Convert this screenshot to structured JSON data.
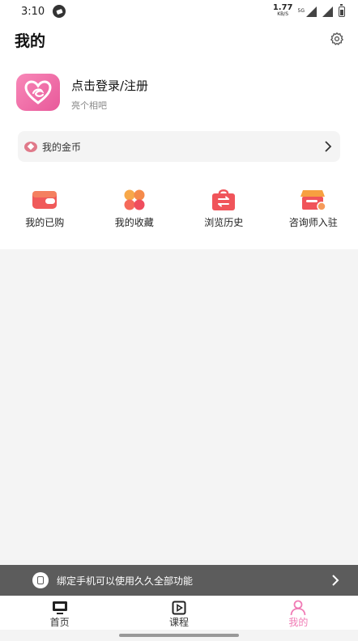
{
  "status_bar": {
    "time": "3:10",
    "net_speed_value": "1.77",
    "net_speed_unit": "KB/S",
    "signal_tag": "5G"
  },
  "header": {
    "title": "我的"
  },
  "profile": {
    "login_label": "点击登录/注册",
    "subtitle": "亮个相吧"
  },
  "coins": {
    "label": "我的金币"
  },
  "shortcuts": [
    {
      "label": "我的已购",
      "icon": "wallet-icon"
    },
    {
      "label": "我的收藏",
      "icon": "clover-icon"
    },
    {
      "label": "浏览历史",
      "icon": "history-bag-icon"
    },
    {
      "label": "咨询师入驻",
      "icon": "shop-icon"
    }
  ],
  "bind_banner": {
    "text": "绑定手机可以使用久久全部功能"
  },
  "tabbar": {
    "items": [
      {
        "label": "首页",
        "icon": "monitor-icon",
        "active": false
      },
      {
        "label": "课程",
        "icon": "video-course-icon",
        "active": false
      },
      {
        "label": "我的",
        "icon": "user-icon",
        "active": true
      }
    ]
  },
  "colors": {
    "accent_pink": "#f07bb5",
    "avatar_pink": "#ec68a6",
    "banner_gray": "#5c5c5c",
    "page_bg": "#f4f4f4"
  }
}
